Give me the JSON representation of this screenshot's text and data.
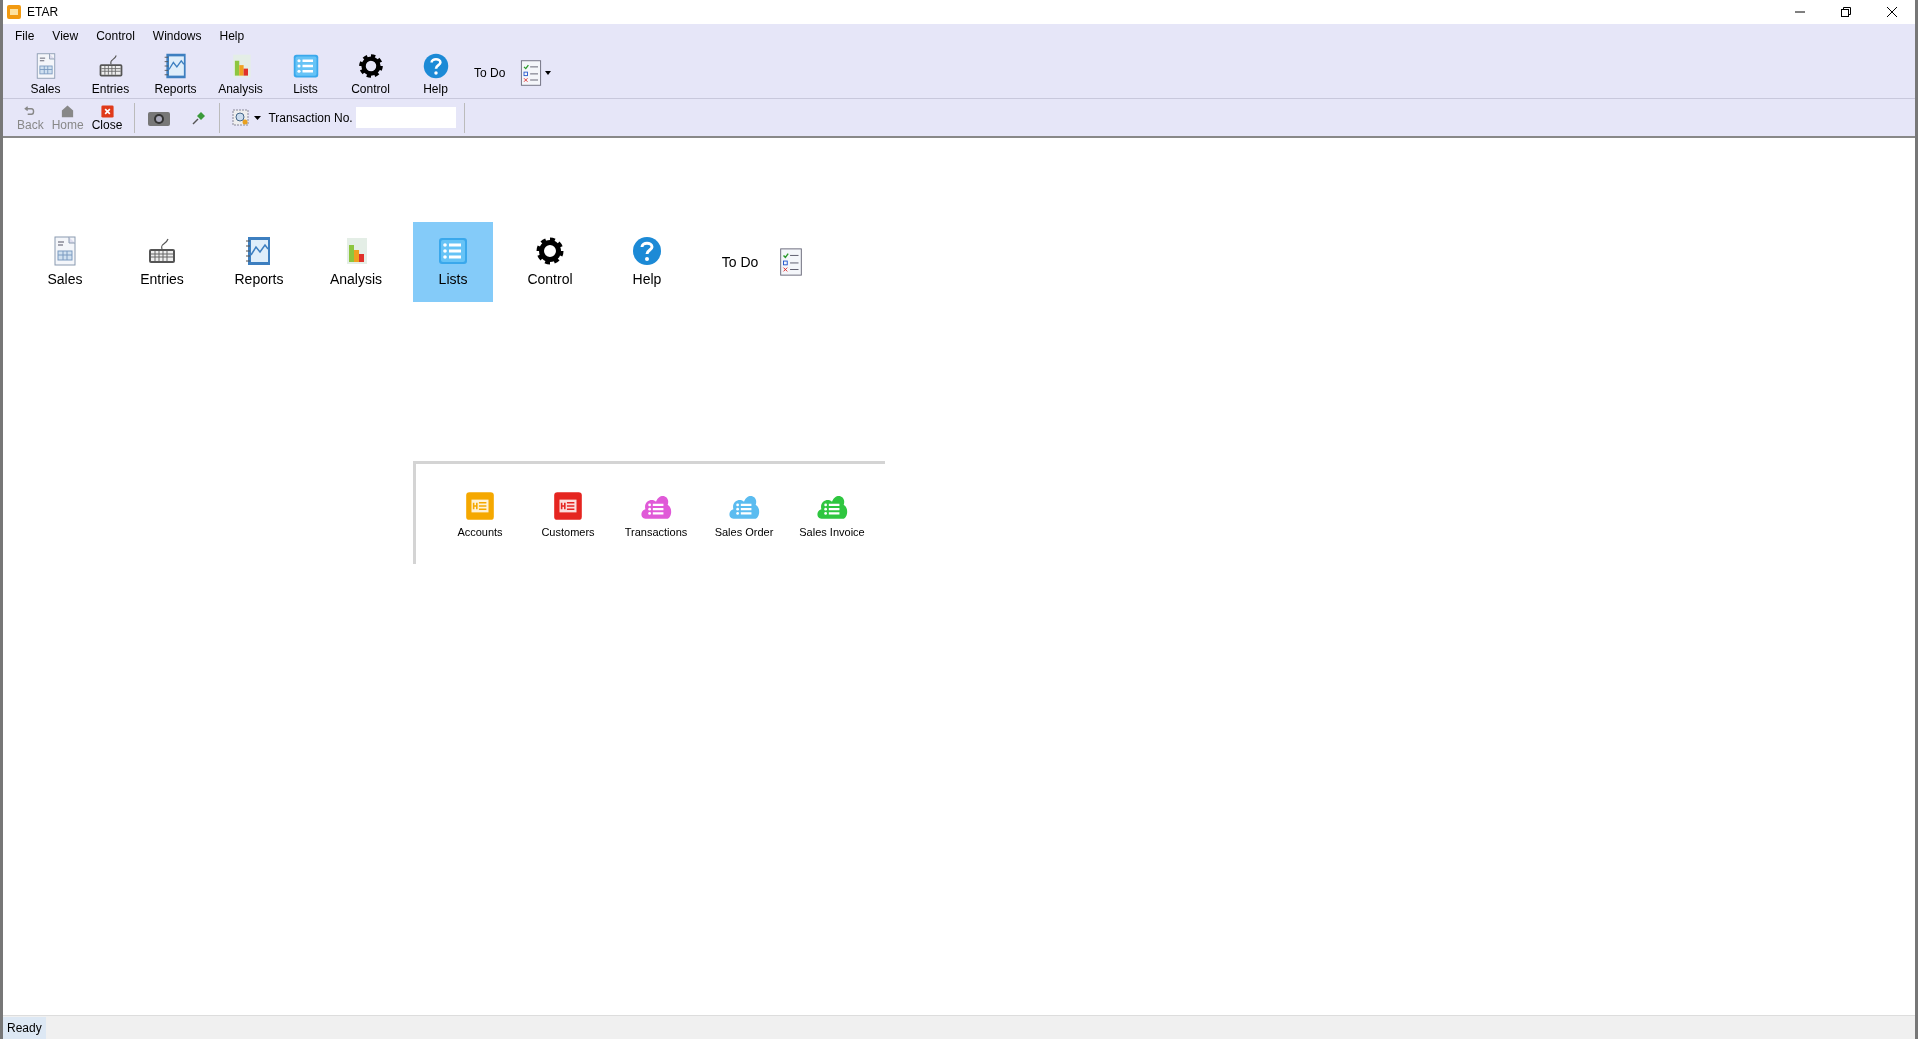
{
  "window": {
    "title": "ETAR"
  },
  "menu": [
    "File",
    "View",
    "Control",
    "Windows",
    "Help"
  ],
  "toolbar": [
    {
      "label": "Sales",
      "kind": "document"
    },
    {
      "label": "Entries",
      "kind": "keyboard"
    },
    {
      "label": "Reports",
      "kind": "notebook"
    },
    {
      "label": "Analysis",
      "kind": "chart"
    },
    {
      "label": "Lists",
      "kind": "list"
    },
    {
      "label": "Control",
      "kind": "gear"
    },
    {
      "label": "Help",
      "kind": "help"
    },
    {
      "label": "To Do",
      "kind": "todo"
    }
  ],
  "nav_toolbar": [
    {
      "label": "Back",
      "kind": "back",
      "disabled": true
    },
    {
      "label": "Home",
      "kind": "home",
      "disabled": true
    },
    {
      "label": "Close",
      "kind": "close",
      "disabled": false
    }
  ],
  "transaction": {
    "label": "Transaction No."
  },
  "tiles": [
    {
      "label": "Sales",
      "kind": "document",
      "selected": false
    },
    {
      "label": "Entries",
      "kind": "keyboard",
      "selected": false
    },
    {
      "label": "Reports",
      "kind": "notebook",
      "selected": false
    },
    {
      "label": "Analysis",
      "kind": "chart",
      "selected": false
    },
    {
      "label": "Lists",
      "kind": "list",
      "selected": true
    },
    {
      "label": "Control",
      "kind": "gear",
      "selected": false
    },
    {
      "label": "Help",
      "kind": "help",
      "selected": false
    },
    {
      "label": "To Do",
      "kind": "todo",
      "selected": false
    }
  ],
  "sub_items": [
    {
      "label": "Accounts",
      "kind": "card",
      "color": "#f5a800"
    },
    {
      "label": "Customers",
      "kind": "card",
      "color": "#e52520"
    },
    {
      "label": "Transactions",
      "kind": "cloud",
      "color": "#e05ad8"
    },
    {
      "label": "Sales Order",
      "kind": "cloud",
      "color": "#5bbcf0"
    },
    {
      "label": "Sales Invoice",
      "kind": "cloud",
      "color": "#2fc640"
    }
  ],
  "status_bar": {
    "text": "Ready"
  }
}
